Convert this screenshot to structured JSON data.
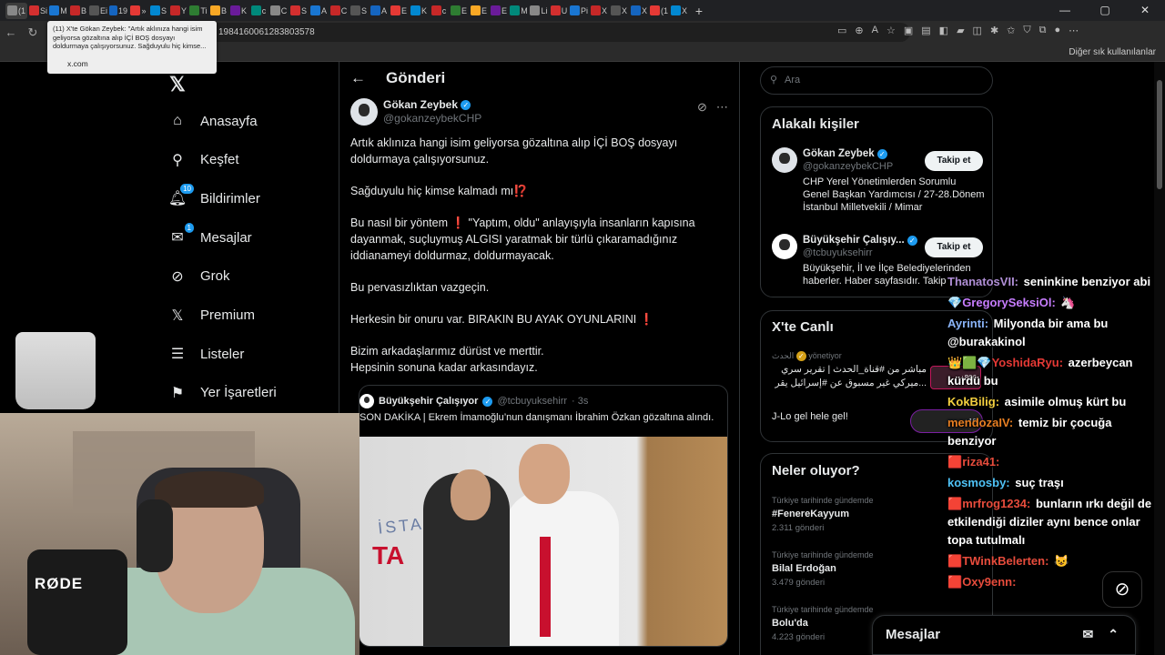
{
  "browser": {
    "tabs": [
      "(1",
      "Si",
      "M",
      "B",
      "Ei",
      "19",
      "»",
      "S",
      "Y",
      "Ti",
      "B",
      "K",
      "c",
      "C",
      "S",
      "A",
      "C",
      "S",
      "A",
      "E",
      "K",
      "c",
      "E",
      "E",
      "E",
      "M",
      "Li",
      "U",
      "Pi",
      "X",
      "X",
      "X",
      "(1",
      "X"
    ],
    "new_tab": "+",
    "url": "1984160061283803578",
    "bookmark_right": "Diğer sık kullanılanlar",
    "tooltip_title": "(11) X'te Gökan Zeybek: \"Artık aklınıza hangi isim geliyorsa gözaltına alıp İÇİ BOŞ dosyayı doldurmaya çalışıyorsunuz. Sağduyulu hiç kimse...",
    "tooltip_domain": "x.com",
    "window_controls": [
      "—",
      "▢",
      "✕"
    ]
  },
  "nav": {
    "logo": "𝕏",
    "items": [
      {
        "label": "Anasayfa",
        "icon": "⌂"
      },
      {
        "label": "Keşfet",
        "icon": "⚲"
      },
      {
        "label": "Bildirimler",
        "icon": "🔔︎",
        "badge": "10"
      },
      {
        "label": "Mesajlar",
        "icon": "✉",
        "badge": "1"
      },
      {
        "label": "Grok",
        "icon": "⊘"
      },
      {
        "label": "Premium",
        "icon": "𝕏"
      },
      {
        "label": "Listeler",
        "icon": "☰"
      },
      {
        "label": "Yer İşaretleri",
        "icon": "⚑"
      }
    ]
  },
  "post": {
    "back": "←",
    "header": "Gönderi",
    "author_name": "Gökan Zeybek",
    "author_handle": "@gokanzeybekCHP",
    "paragraphs": [
      [
        "Artık aklınıza hangi isim geliyorsa gözaltına alıp İÇİ BOŞ dosyayı doldurmaya çalışıyorsunuz."
      ],
      [
        "Sağduyulu hiç kimse kalmadı mı",
        "⁉️"
      ],
      [
        "Bu nasıl bir yöntem ",
        "❗",
        " \"Yaptım, oldu\" anlayışıyla insanların kapısına dayanmak, suçluymuş ALGISI yaratmak bir türlü çıkaramadığınız iddianameyi doldurmaz, doldurmayacak."
      ],
      [
        "Bu pervasızlıktan vazgeçin."
      ],
      [
        "Herkesin bir onuru var. BIRAKIN BU AYAK OYUNLARINI ",
        "❗"
      ],
      [
        "Bizim arkadaşlarımız dürüst ve merttir.",
        "Hepsinin sonuna kadar arkasındayız."
      ]
    ],
    "quote": {
      "name": "Büyükşehir Çalışıyor",
      "handle": "@tcbuyuksehirr",
      "time": "· 3s",
      "text": "SON DAKİKA | Ekrem İmamoğlu’nun danışmanı İbrahim Özkan gözaltına alındı.",
      "photo_text": "İSTANBUL",
      "photo_text2": "TA"
    }
  },
  "right": {
    "search_placeholder": "Ara",
    "related_title": "Alakalı kişiler",
    "people": [
      {
        "name": "Gökan Zeybek",
        "handle": "@gokanzeybekCHP",
        "bio": "CHP Yerel Yönetimlerden Sorumlu Genel Başkan Yardımcısı / 27-28.Dönem İstanbul Milletvekili / Mimar",
        "follow": "Takip et"
      },
      {
        "name": "Büyükşehir Çalışıy...",
        "handle": "@tcbuyuksehirr",
        "bio": "Büyükşehir, İl ve İlçe Belediyelerinden haberler. Haber sayfasıdır. Takip",
        "follow": "Takip et"
      }
    ],
    "live_title": "X'te Canlı",
    "live_items": [
      {
        "host": "الحدث",
        "status": "yönetiyor",
        "text": "مباشر من #قناة_الحدث | تقرير سري ...ميركي غير مسبوق عن #إسرائيل يقر",
        "count": "+806"
      },
      {
        "text": "J-Lo gel hele gel!",
        "count": "+10"
      }
    ],
    "trends_title": "Neler oluyor?",
    "trends": [
      {
        "context": "Türkiye tarihinde gündemde",
        "title": "#FenereKayyum",
        "count": "2.311 gönderi"
      },
      {
        "context": "Türkiye tarihinde gündemde",
        "title": "Bilal Erdoğan",
        "count": "3.479 gönderi"
      },
      {
        "context": "Türkiye tarihinde gündemde",
        "title": "Bolu'da",
        "count": "4.223 gönderi"
      }
    ],
    "messages_label": "Mesajlar"
  },
  "stream_chat": [
    {
      "user": "ThanatosVII",
      "color": "#b08fd6",
      "text": "seninkine benziyor abi"
    },
    {
      "user": "GregorySeksiOl",
      "color": "#c77dff",
      "text": "🦄",
      "prefix": "💎"
    },
    {
      "user": "Ayrinti",
      "color": "#8ab4f8",
      "text": "Milyonda bir ama bu @burakakinol"
    },
    {
      "user": "YoshidaRyu",
      "color": "#e53935",
      "text": "azerbeycan kürdü bu",
      "prefix": "👑🟩💎"
    },
    {
      "user": "KokBilig",
      "color": "#f4d03f",
      "text": "asimile olmuş kürt bu"
    },
    {
      "user": "mendozaIV",
      "color": "#e67e22",
      "text": "temiz bir çocuğa benziyor"
    },
    {
      "user": "riza41",
      "color": "#e74c3c",
      "text": "",
      "prefix": "🟥"
    },
    {
      "user": "kosmosby",
      "color": "#4fc3f7",
      "text": "suç traşı"
    },
    {
      "user": "mrfrog1234",
      "color": "#e74c3c",
      "text": "bunların ırkı değil de etkilendiği diziler aynı bence onlar topa tutulmalı",
      "prefix": "🟥"
    },
    {
      "user": "TWinkBelerten",
      "color": "#e74c3c",
      "text": "😺",
      "prefix": "🟥"
    },
    {
      "user": "Oxy9enn",
      "color": "#e74c3c",
      "text": "",
      "prefix": "🟥"
    }
  ],
  "webcam": {
    "mic_brand": "RØDE"
  }
}
